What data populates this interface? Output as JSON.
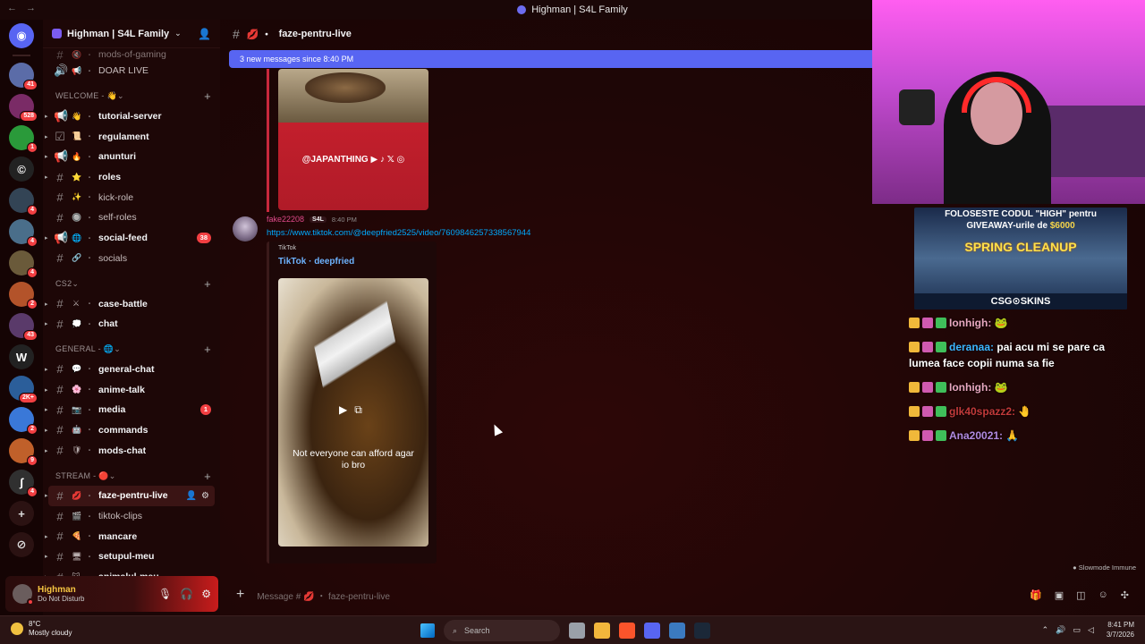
{
  "window": {
    "title": "Highman | S4L Family",
    "nav_back": "←",
    "nav_forward": "→"
  },
  "rail": {
    "servers": [
      {
        "name": "direct-messages",
        "glyph": "◉",
        "color": "#5865f2",
        "badge": ""
      },
      {
        "name": "server-1",
        "glyph": "",
        "color": "#5b6ca8",
        "badge": "41"
      },
      {
        "name": "server-2",
        "glyph": "",
        "color": "#7a2b66",
        "badge": "528"
      },
      {
        "name": "server-3",
        "glyph": "",
        "color": "#2a9a3a",
        "badge": "1"
      },
      {
        "name": "server-4",
        "glyph": "©",
        "color": "#222222",
        "badge": ""
      },
      {
        "name": "server-5",
        "glyph": "",
        "color": "#334455",
        "badge": "4"
      },
      {
        "name": "server-6",
        "glyph": "",
        "color": "#4a6e8a",
        "badge": "4"
      },
      {
        "name": "server-7",
        "glyph": "",
        "color": "#6a5a3a",
        "badge": "4"
      },
      {
        "name": "server-8",
        "glyph": "",
        "color": "#b3532a",
        "badge": "2"
      },
      {
        "name": "server-9",
        "glyph": "",
        "color": "#5a3a6a",
        "badge": "43"
      },
      {
        "name": "server-10",
        "glyph": "W",
        "color": "#222222",
        "badge": ""
      },
      {
        "name": "server-11",
        "glyph": "",
        "color": "#2b5e9a",
        "badge": "2K+"
      },
      {
        "name": "server-12",
        "glyph": "",
        "color": "#3a78d8",
        "badge": "2"
      },
      {
        "name": "server-13",
        "glyph": "",
        "color": "#c0602a",
        "badge": "9"
      },
      {
        "name": "server-14",
        "glyph": "ʃ",
        "color": "#303030",
        "badge": "4"
      }
    ],
    "add_server": "+",
    "discover": "⊘"
  },
  "guild": {
    "name": "Highman | S4L Family"
  },
  "sidebar": {
    "top_channels": [
      {
        "emoji": "🔇",
        "name": "mods-of-gaming",
        "hash": "#"
      },
      {
        "emoji": "📢",
        "name": "DOAR LIVE",
        "hash": "🔊"
      }
    ],
    "categories": [
      {
        "label": "WELCOME - 👋",
        "channels": [
          {
            "icon": "📢",
            "emoji": "👋",
            "name": "tutorial-server",
            "unread": true,
            "badge": ""
          },
          {
            "icon": "☑",
            "emoji": "📜",
            "name": "regulament",
            "unread": true,
            "badge": ""
          },
          {
            "icon": "📢",
            "emoji": "🔥",
            "name": "anunturi",
            "unread": true,
            "badge": ""
          },
          {
            "icon": "#",
            "emoji": "⭐",
            "name": "roles",
            "unread": true,
            "badge": ""
          },
          {
            "icon": "#",
            "emoji": "✨",
            "name": "kick-role",
            "unread": false,
            "badge": ""
          },
          {
            "icon": "#",
            "emoji": "🔘",
            "name": "self-roles",
            "unread": false,
            "badge": ""
          },
          {
            "icon": "📢",
            "emoji": "🌐",
            "name": "social-feed",
            "unread": true,
            "badge": "38"
          },
          {
            "icon": "#",
            "emoji": "🔗",
            "name": "socials",
            "unread": false,
            "badge": ""
          }
        ]
      },
      {
        "label": "CS2",
        "channels": [
          {
            "icon": "#",
            "emoji": "⚔",
            "name": "case-battle",
            "unread": true,
            "badge": ""
          },
          {
            "icon": "#",
            "emoji": "💭",
            "name": "chat",
            "unread": true,
            "badge": ""
          }
        ]
      },
      {
        "label": "GENERAL - 🌐",
        "channels": [
          {
            "icon": "#",
            "emoji": "💬",
            "name": "general-chat",
            "unread": true,
            "badge": ""
          },
          {
            "icon": "#",
            "emoji": "🌸",
            "name": "anime-talk",
            "unread": true,
            "badge": ""
          },
          {
            "icon": "#",
            "emoji": "📷",
            "name": "media",
            "unread": true,
            "badge": "1"
          },
          {
            "icon": "#",
            "emoji": "🤖",
            "name": "commands",
            "unread": true,
            "badge": ""
          },
          {
            "icon": "#",
            "emoji": "🛡",
            "name": "mods-chat",
            "unread": true,
            "badge": ""
          }
        ]
      },
      {
        "label": "STREAM - 🔴",
        "channels": [
          {
            "icon": "#",
            "emoji": "💋",
            "name": "faze-pentru-live",
            "unread": true,
            "badge": "",
            "active": true
          },
          {
            "icon": "#",
            "emoji": "🎬",
            "name": "tiktok-clips",
            "unread": false,
            "badge": ""
          },
          {
            "icon": "#",
            "emoji": "🍕",
            "name": "mancare",
            "unread": true,
            "badge": ""
          },
          {
            "icon": "#",
            "emoji": "🖥",
            "name": "setupul-meu",
            "unread": true,
            "badge": ""
          },
          {
            "icon": "#",
            "emoji": "🐱",
            "name": "animalul-meu",
            "unread": true,
            "badge": ""
          }
        ]
      }
    ]
  },
  "user": {
    "name": "Highman",
    "status": "Do Not Disturb"
  },
  "channel": {
    "name": "faze-pentru-live",
    "new_messages_banner": "3 new messages since 8:40 PM"
  },
  "embed_top": {
    "handle": "@JAPANTHING ▶ ♪ 𝕏 ◎"
  },
  "message": {
    "author": "fake22208",
    "tag": "S4L",
    "time": "8:40 PM",
    "link": "https://www.tiktok.com/@deepfried2525/video/7609846257338567944",
    "embed_provider": "TikTok",
    "embed_title": "TikTok · deepfried",
    "video_caption": "Not everyone can afford agar io bro"
  },
  "composer": {
    "placeholder": "Message # 💋 ・ faze-pentru-live",
    "slowmode": "Slowmode Immune"
  },
  "ad": {
    "line1": "FOLOSESTE CODUL \"HIGH\" pentru",
    "line2_prefix": "GIVEAWAY-urile de ",
    "line2_amount": "$6000",
    "banner": "SPRING CLEANUP",
    "brand": "CSG⊙SKINS"
  },
  "twitch_chat": [
    {
      "user": "Ionhigh:",
      "text": "🐸",
      "cls": "u1"
    },
    {
      "user": "deranaa:",
      "text": "pai acu mi se pare ca lumea face copii numa sa fie",
      "cls": "u2"
    },
    {
      "user": "Ionhigh:",
      "text": "🐸",
      "cls": "u1"
    },
    {
      "user": "glk40spazz2:",
      "text": "🤚",
      "cls": "u3"
    },
    {
      "user": "Ana20021:",
      "text": "🙏",
      "cls": "u4"
    }
  ],
  "taskbar": {
    "temp": "8°C",
    "weather": "Mostly cloudy",
    "search": "Search",
    "time": "8:41 PM",
    "date": "3/7/2026"
  }
}
